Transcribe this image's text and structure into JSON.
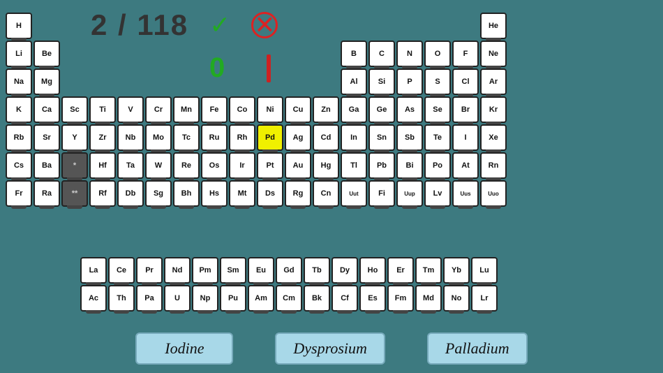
{
  "header": {
    "counter": "2 / 118",
    "check_label": "✔",
    "cross_label": "⊗",
    "score_correct": "0",
    "score_wrong": "|"
  },
  "bottom_labels": [
    "Iodine",
    "Dysprosium",
    "Palladium"
  ],
  "elements_row1": [
    "H",
    "",
    "",
    "",
    "",
    "",
    "",
    "",
    "",
    "",
    "",
    "",
    "",
    "",
    "",
    "",
    "",
    "He"
  ],
  "elements_row2": [
    "Li",
    "Be",
    "",
    "",
    "",
    "",
    "",
    "",
    "",
    "",
    "",
    "",
    "B",
    "C",
    "N",
    "O",
    "F",
    "Ne"
  ],
  "elements_row3": [
    "Na",
    "Mg",
    "",
    "",
    "",
    "",
    "",
    "",
    "",
    "",
    "",
    "",
    "Al",
    "Si",
    "P",
    "S",
    "Cl",
    "Ar"
  ],
  "elements_row4": [
    "K",
    "Ca",
    "Sc",
    "Ti",
    "V",
    "Cr",
    "Mn",
    "Fe",
    "Co",
    "Ni",
    "Cu",
    "Zn",
    "Ga",
    "Ge",
    "As",
    "Se",
    "Br",
    "Kr"
  ],
  "elements_row5": [
    "Rb",
    "Sr",
    "Y",
    "Zr",
    "Nb",
    "Mo",
    "Tc",
    "Ru",
    "Rh",
    "Pd",
    "Ag",
    "Cd",
    "In",
    "Sn",
    "Sb",
    "Te",
    "I",
    "Xe"
  ],
  "elements_row6": [
    "Cs",
    "Ba",
    "",
    "Hf",
    "Ta",
    "W",
    "Re",
    "Os",
    "Ir",
    "Pt",
    "Au",
    "Hg",
    "Tl",
    "Pb",
    "Bi",
    "Po",
    "At",
    "Rn"
  ],
  "elements_row7": [
    "Fr",
    "Ra",
    "",
    "Rf",
    "Db",
    "Sg",
    "Bh",
    "Hs",
    "Mt",
    "Ds",
    "Rg",
    "Cn",
    "Uut",
    "Fi",
    "Uup",
    "Lv",
    "Uus",
    "Uuo"
  ],
  "lanthanides": [
    "La",
    "Ce",
    "Pr",
    "Nd",
    "Pm",
    "Sm",
    "Eu",
    "Gd",
    "Tb",
    "Dy",
    "Ho",
    "Er",
    "Tm",
    "Yb",
    "Lu"
  ],
  "actinides": [
    "Ac",
    "Th",
    "Pa",
    "U",
    "Np",
    "Pu",
    "Am",
    "Cm",
    "Bk",
    "Cf",
    "Es",
    "Fm",
    "Md",
    "No",
    "Lr"
  ],
  "highlighted_element": "Pd"
}
